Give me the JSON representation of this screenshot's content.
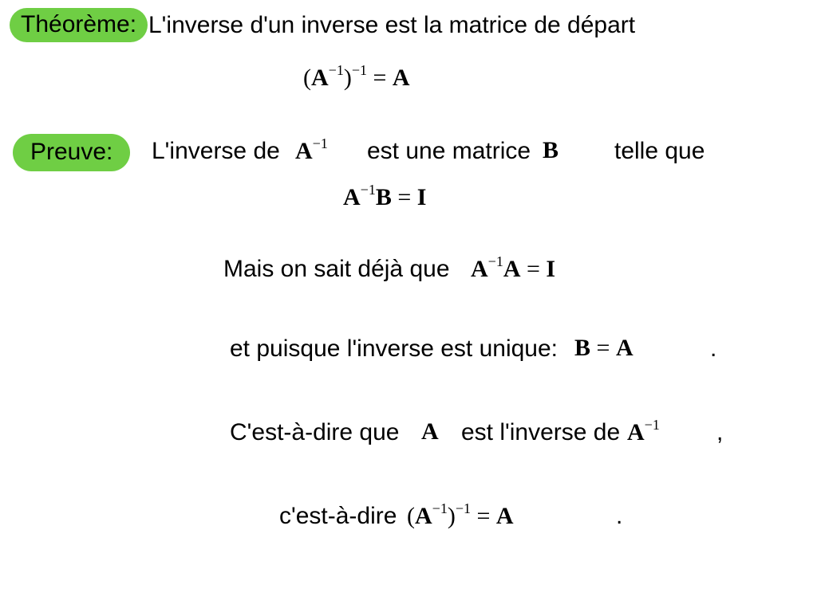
{
  "labels": {
    "theorem": "Théorème:",
    "proof": "Preuve:"
  },
  "theorem_statement": "L'inverse d'un inverse est la matrice de départ",
  "proof": {
    "line1_a": "L'inverse de",
    "line1_b": "est une matrice",
    "line1_c": "telle que",
    "line2": "Mais on sait déjà que",
    "line3": "et puisque l'inverse est unique:",
    "dot": ".",
    "line4_a": "C'est-à-dire que",
    "line4_b": "est l'inverse de",
    "comma": ",",
    "line5": "c'est-à-dire"
  },
  "math": {
    "A": "A",
    "B": "B",
    "I": "I",
    "minus1": "−1",
    "eq": "=",
    "lp": "(",
    "rp": ")"
  }
}
